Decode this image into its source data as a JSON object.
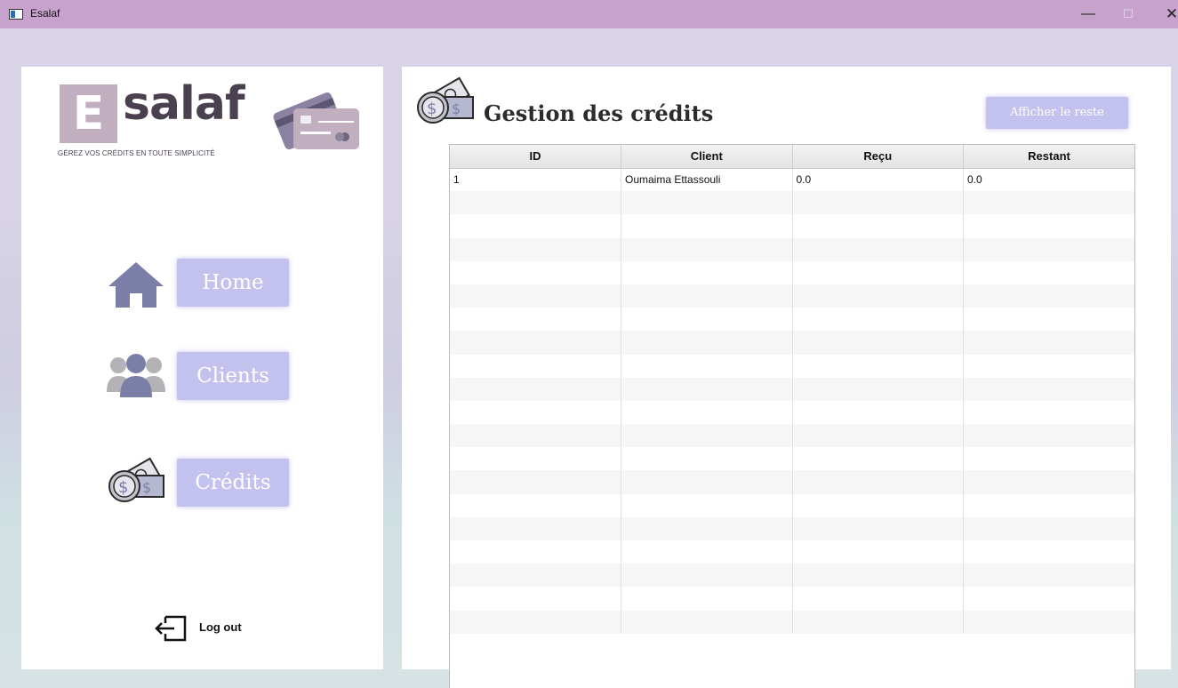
{
  "window": {
    "title": "Esalaf",
    "minimize_glyph": "—",
    "maximize_glyph": "☐",
    "close_glyph": "✕"
  },
  "sidebar": {
    "logo": {
      "letter": "E",
      "word": "salaf",
      "tagline": "GÉREZ VOS CRÉDITS EN TOUTE SIMPLICITÉ"
    },
    "nav": [
      {
        "label": "Home",
        "icon": "home-icon"
      },
      {
        "label": "Clients",
        "icon": "users-icon"
      },
      {
        "label": "Crédits",
        "icon": "money-icon"
      }
    ],
    "logout": {
      "label": "Log out",
      "icon": "logout-icon"
    }
  },
  "main": {
    "title": "Gestion des crédits",
    "title_icon": "money-icon",
    "action_button": "Afficher le reste",
    "table": {
      "columns": [
        "ID",
        "Client",
        "Reçu",
        "Restant"
      ],
      "rows": [
        [
          "1",
          "Oumaima Ettassouli",
          "0.0",
          "0.0"
        ]
      ],
      "empty_rows": 19
    }
  },
  "colors": {
    "titlebar": "#c6a2cc",
    "button": "#c3c1ee",
    "icon": "#7b7fa8",
    "logo_box": "#c1afbf"
  }
}
